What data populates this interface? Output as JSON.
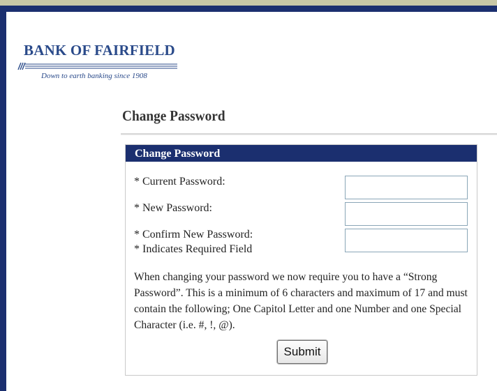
{
  "brand": {
    "name": "BANK OF FAIRFIELD",
    "tagline": "Down to earth banking since 1908"
  },
  "page": {
    "title": "Change Password"
  },
  "form": {
    "header": "Change Password",
    "fields": [
      {
        "label": "* Current Password:",
        "value": ""
      },
      {
        "label": "* New Password:",
        "value": ""
      },
      {
        "label": "* Confirm New Password:",
        "value": ""
      }
    ],
    "required_note": "* Indicates Required Field",
    "password_rules": "When changing your password we now require you to have a “Strong Password”. This is a minimum of 6 characters and maximum of 17 and must contain the following; One Capitol Letter and one Number and one Special Character (i.e. #, !, @).",
    "submit_label": "Submit"
  },
  "colors": {
    "frame": "#1b2f6f",
    "header_bar": "#1b2f6f",
    "brand_blue": "#2a4a8a",
    "top_strip": "#c8c7a6"
  }
}
